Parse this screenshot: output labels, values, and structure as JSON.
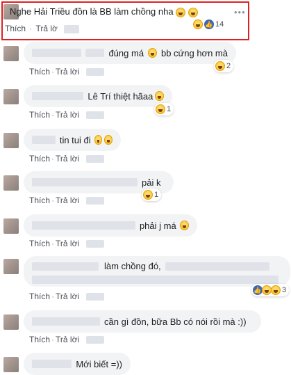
{
  "actions": {
    "like": "Thích",
    "reply": "Trả lời",
    "reply_truncated": "Trả lờ"
  },
  "comments": [
    {
      "text": "Nghe Hải Triều đồn là BB làm chồng nha",
      "reaction_count": "14"
    },
    {
      "text": "đúng má",
      "text2": "bb cứng hơn mà",
      "reaction_count": "2"
    },
    {
      "text": "Lê Trí thiệt hãaa",
      "reaction_count": "1"
    },
    {
      "text": "tin tui đi",
      "reaction_count": ""
    },
    {
      "text": "pải k",
      "reaction_count": "1"
    },
    {
      "text": "phải j má",
      "reaction_count": ""
    },
    {
      "text": "làm chồng đó,",
      "reaction_count": "3"
    },
    {
      "text": "cần gì đồn, bữa Bb có nói rồi mà :))",
      "reaction_count": ""
    },
    {
      "text": "Mới biết =))",
      "reaction_count": ""
    }
  ],
  "more_label": "•••",
  "icons": {
    "like": "thumbs-up-icon",
    "haha": "laughing-emoji-icon",
    "smile": "smile-emoji-icon",
    "sad": "sad-emoji-icon",
    "more": "more-options-icon"
  },
  "colors": {
    "highlight": "#e02020",
    "link": "#4b4f56",
    "bubble": "#f2f3f5",
    "like": "#4267b2"
  }
}
